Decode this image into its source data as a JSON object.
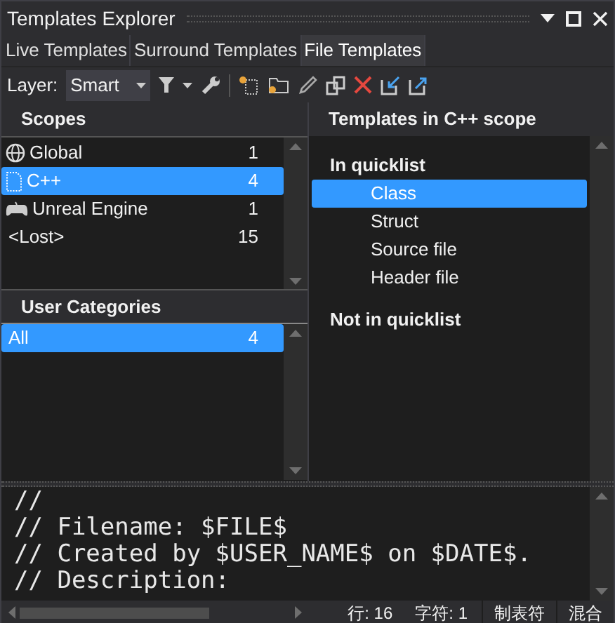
{
  "window": {
    "title": "Templates Explorer"
  },
  "tabs": [
    {
      "label": "Live Templates",
      "selected": false
    },
    {
      "label": "Surround Templates",
      "selected": false
    },
    {
      "label": "File Templates",
      "selected": true
    }
  ],
  "toolbar": {
    "layer_label": "Layer:",
    "layer_value": "Smart"
  },
  "scopes": {
    "header": "Scopes",
    "items": [
      {
        "kind": "globe",
        "name": "Global",
        "count": "1",
        "selected": false
      },
      {
        "kind": "file",
        "name": "C++",
        "count": "4",
        "selected": true
      },
      {
        "kind": "gamepad",
        "name": "Unreal Engine",
        "count": "1",
        "selected": false
      },
      {
        "kind": "plain",
        "name": "<Lost>",
        "count": "15",
        "selected": false
      }
    ]
  },
  "user_categories": {
    "header": "User Categories",
    "items": [
      {
        "name": "All",
        "count": "4",
        "selected": true
      }
    ]
  },
  "templates": {
    "header": "Templates in C++ scope",
    "groups": [
      {
        "title": "In quicklist",
        "items": [
          {
            "name": "Class",
            "selected": true
          },
          {
            "name": "Struct",
            "selected": false
          },
          {
            "name": "Source file",
            "selected": false
          },
          {
            "name": "Header file",
            "selected": false
          }
        ]
      },
      {
        "title": "Not in quicklist"
      }
    ]
  },
  "editor": {
    "lines": [
      "//",
      "// Filename: $FILE$",
      "// Created by $USER_NAME$ on $DATE$.",
      "// Description:"
    ]
  },
  "status_bar": {
    "line": "行: 16",
    "column": "字符: 1",
    "indent": "制表符",
    "mode": "混合"
  }
}
